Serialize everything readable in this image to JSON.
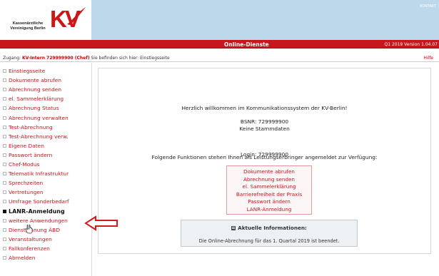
{
  "brand": {
    "logo_line1": "Kassenärztliche",
    "logo_line2": "Vereinigung Berlin",
    "logo_mark": "KV",
    "colors": {
      "red": "#c8161d",
      "header_blue": "#bcd8ea"
    }
  },
  "header": {
    "kontakt": "KONTAKT",
    "title": "Online-Dienste",
    "version": "Q1 2019 Version 1.04.07"
  },
  "status": {
    "zugang_label": "Zugang:",
    "kv_user": "KV-Intern 729999900 (Chef)",
    "location_text": "Sie befinden sich hier: Einstiegsseite",
    "help": "Hilfe"
  },
  "sidebar": {
    "items": [
      {
        "label": "Einstiegsseite"
      },
      {
        "label": "Dokumente abrufen"
      },
      {
        "label": "Abrechnung senden"
      },
      {
        "label": "el. Sammelerklärung"
      },
      {
        "label": "Abrechnung Status"
      },
      {
        "label": "Abrechnung verwalten"
      },
      {
        "label": "Test-Abrechnung"
      },
      {
        "label": "Test-Abrechnung verw."
      },
      {
        "label": "Eigene Daten"
      },
      {
        "label": "Passwort ändern"
      },
      {
        "label": "Chef-Modus"
      },
      {
        "label": "Telematik Infrastruktur"
      },
      {
        "label": "Sprechzeiten"
      },
      {
        "label": "Vertretungen"
      },
      {
        "label": "Umfrage Sonderbedarf"
      },
      {
        "label": "LANR-Anmeldung",
        "active": true
      },
      {
        "label": "weitere Anwendungen"
      },
      {
        "label": "Dienstplanung ÄBD"
      },
      {
        "label": "Veranstaltungen"
      },
      {
        "label": "Fallkonferenzen"
      },
      {
        "label": "Abmelden"
      }
    ]
  },
  "main": {
    "welcome": "Herzlich willkommen im Kommunikationssystem der KV-Berlin!",
    "bsnr": "BSNR: 729999900",
    "stammdaten": "Keine Stammdaten",
    "login": "Login: 729999900",
    "functions_intro": "Folgende Funktionen stehen Ihnen als Leistungserbringer angemeldet zur Verfügung:",
    "functions": [
      "Dokumente abrufen",
      "Abrechnung senden",
      "el. Sammelerklärung",
      "Barrierefreiheit der Praxis",
      "Passwort ändern",
      "LANR-Anmeldung"
    ],
    "info_title": "Aktuelle Informationen:",
    "info_text": "Die Online-Abrechnung für das 1. Quartal 2019 ist beendet."
  },
  "annotations": {
    "arrow_icon": "red-outline-arrow-left",
    "cursor_icon": "hand-cursor"
  }
}
